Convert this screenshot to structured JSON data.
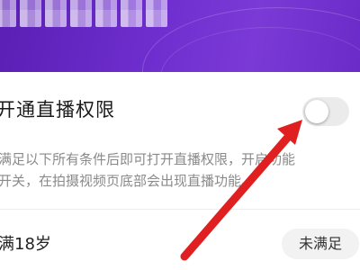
{
  "permission": {
    "title": "开通直播权限",
    "toggle_on": false,
    "description_line1": "满足以下所有条件后即可打开直播权限，开启功能",
    "description_line2": "开关，在拍摄视频页底部会出现直播功能。"
  },
  "requirements": [
    {
      "label": "满18岁",
      "status": "未满足"
    }
  ],
  "colors": {
    "banner": "#6f2fd0",
    "arrow": "#e02020",
    "toggle_off": "#ebebeb"
  }
}
